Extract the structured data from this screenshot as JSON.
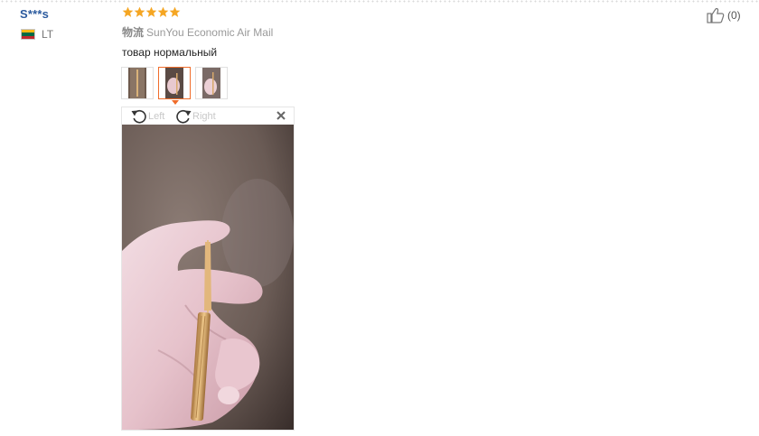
{
  "review": {
    "user": {
      "name": "S***s",
      "country_code": "LT"
    },
    "rating": {
      "stars": 5,
      "max": 5
    },
    "logistics": {
      "label": "物流",
      "value": "SunYou Economic Air Mail"
    },
    "text": "товар нормальный",
    "photos": {
      "count": 3,
      "selected_index": 1
    },
    "viewer": {
      "rotate_left_label": "Left",
      "rotate_right_label": "Right"
    },
    "helpful": {
      "count": "(0)"
    }
  },
  "colors": {
    "username": "#2b5a9e",
    "star": "#f5a623",
    "active_border": "#f06c2a",
    "flag_lithuania": [
      "#fdb913",
      "#006a44",
      "#c1272d"
    ]
  },
  "icons": [
    "star-icon",
    "lithuania-flag-icon",
    "rotate-left-icon",
    "rotate-right-icon",
    "close-icon",
    "thumbs-up-icon"
  ]
}
